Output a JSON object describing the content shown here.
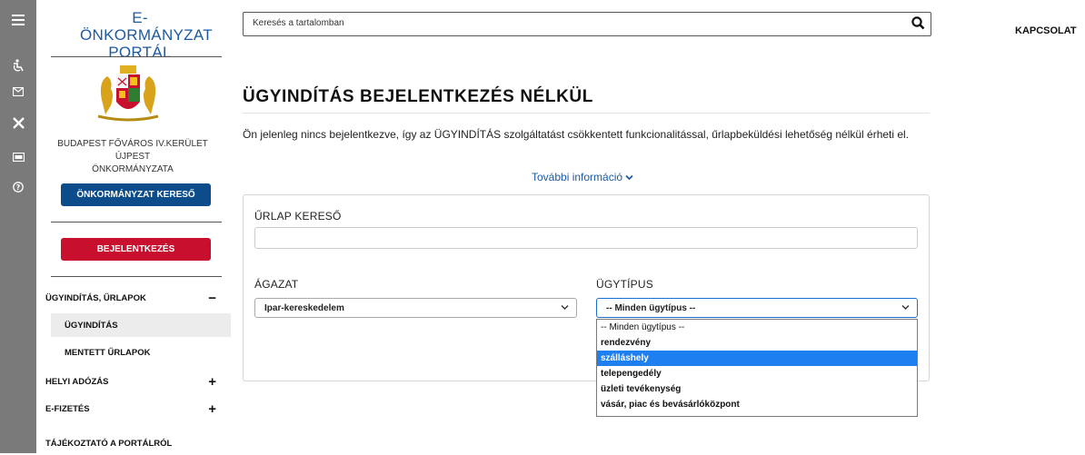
{
  "rail": {
    "icons": [
      "menu-icon",
      "accessibility-icon",
      "mail-icon",
      "tools-icon",
      "id-card-icon",
      "help-icon"
    ]
  },
  "sidebar": {
    "brand_line1": "E-ÖNKORMÁNYZAT",
    "brand_line2": "PORTÁL",
    "org_line1": "BUDAPEST FŐVÁROS IV.KERÜLET ÚJPEST",
    "org_line2": "ÖNKORMÁNYZATA",
    "search_button": "ÖNKORMÁNYZAT KERESŐ",
    "login_button": "BEJELENTKEZÉS",
    "nav": [
      {
        "label": "ÜGYINDÍTÁS, ŰRLAPOK",
        "toggle": "−"
      },
      {
        "label": "ÜGYINDÍTÁS",
        "toggle": ""
      },
      {
        "label": "MENTETT ŰRLAPOK",
        "toggle": ""
      },
      {
        "label": "HELYI ADÓZÁS",
        "toggle": "+"
      },
      {
        "label": "E-FIZETÉS",
        "toggle": "+"
      },
      {
        "label": "TÁJÉKOZTATÓ A PORTÁLRÓL",
        "toggle": ""
      }
    ]
  },
  "header": {
    "search_placeholder": "Keresés a tartalomban",
    "contact": "KAPCSOLAT"
  },
  "main": {
    "title": "ÜGYINDÍTÁS BEJELENTKEZÉS NÉLKÜL",
    "info": "Ön jelenleg nincs bejelentkezve, így az ÜGYINDÍTÁS szolgáltatást csökkentett funkcionalitással, űrlapbeküldési lehetőség nélkül érheti el.",
    "more_info": "További információ",
    "form_search_label": "ŰRLAP KERESŐ",
    "sector_label": "ÁGAZAT",
    "sector_value": "Ipar-kereskedelem",
    "casetype_label": "ÜGYTÍPUS",
    "casetype_value": "-- Minden ügytípus --",
    "casetype_options": [
      "-- Minden ügytípus --",
      "rendezvény",
      "szálláshely",
      "telepengedély",
      "üzleti tevékenység",
      "vásár, piac és bevásárlóközpont"
    ],
    "highlighted_option": 2
  }
}
